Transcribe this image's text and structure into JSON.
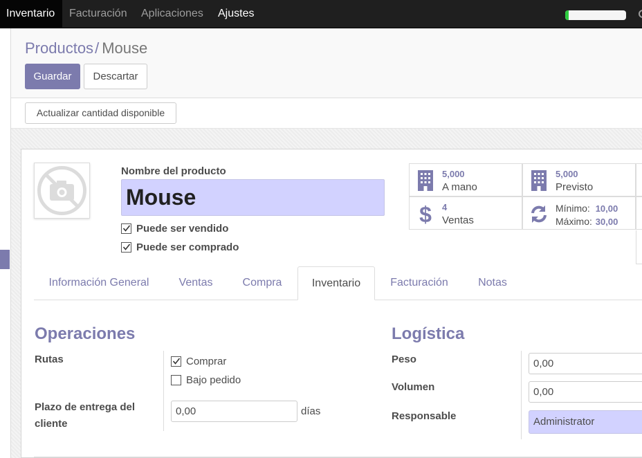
{
  "navbar": {
    "apps": [
      "Inventario",
      "Facturación",
      "Aplicaciones",
      "Ajustes"
    ],
    "progress_percent": 6
  },
  "breadcrumb": {
    "parent": "Productos",
    "separator": "/",
    "current": "Mouse"
  },
  "buttons": {
    "save": "Guardar",
    "discard": "Descartar",
    "update_qty": "Actualizar cantidad disponible"
  },
  "product": {
    "name_label": "Nombre del producto",
    "name": "Mouse",
    "can_be_sold": "Puede ser vendido",
    "can_be_purchased": "Puede ser comprado"
  },
  "stats": {
    "on_hand": {
      "value": "5,000",
      "label": "A mano",
      "icon": "building-icon"
    },
    "forecast": {
      "value": "5,000",
      "label": "Previsto",
      "icon": "building-icon"
    },
    "sales": {
      "value": "4",
      "label": "Ventas",
      "icon": "dollar-icon"
    },
    "reorder": {
      "min_label": "Mínimo:",
      "min": "10,00",
      "max_label": "Máximo:",
      "max": "30,00",
      "icon": "refresh-icon"
    }
  },
  "tabs": [
    "Información General",
    "Ventas",
    "Compra",
    "Inventario",
    "Facturación",
    "Notas"
  ],
  "operations": {
    "title": "Operaciones",
    "routes_label": "Rutas",
    "route_buy": "Comprar",
    "route_mto": "Bajo pedido",
    "lead_label_1": "Plazo de entrega del",
    "lead_label_2": "cliente",
    "lead_value": "0,00",
    "lead_unit": "días"
  },
  "logistics": {
    "title": "Logística",
    "weight_label": "Peso",
    "weight_value": "0,00",
    "volume_label": "Volumen",
    "volume_value": "0,00",
    "responsible_label": "Responsable",
    "responsible_value": "Administrator"
  },
  "colors": {
    "brand": "#7c7bad",
    "required": "#d2d2ff",
    "navbar": "#1f1f1f",
    "progress": "#2ecc40"
  }
}
